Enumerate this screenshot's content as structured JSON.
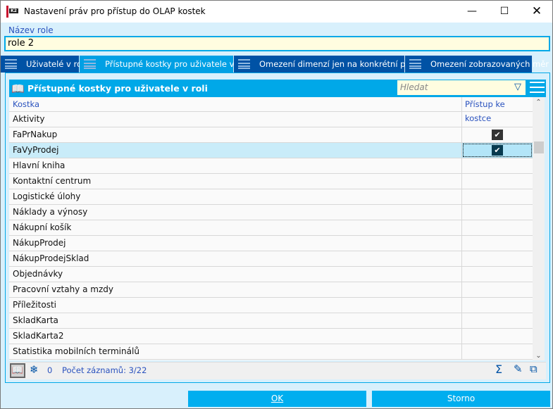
{
  "window": {
    "title": "Nastavení práv pro přístup do OLAP kostek",
    "logo": "K2"
  },
  "role": {
    "label": "Název role",
    "value": "role 2"
  },
  "tabs": [
    {
      "label": "Uživatelé v roli",
      "active": false
    },
    {
      "label": "Přístupné kostky pro uživatele v roli",
      "active": true
    },
    {
      "label": "Omezení dimenzí jen na konkrétní prvky",
      "active": false
    },
    {
      "label": "Omezení zobrazovaných měr",
      "active": false
    }
  ],
  "panel": {
    "title": "Přístupné kostky pro uživatele v roli",
    "search_placeholder": "Hledat"
  },
  "table": {
    "columns": [
      "Kostka",
      "Přístup ke kostce"
    ],
    "rows": [
      {
        "name": "Aktivity",
        "access": false
      },
      {
        "name": "FaPrNakup",
        "access": true
      },
      {
        "name": "FaVyProdej",
        "access": true,
        "selected": true
      },
      {
        "name": "Hlavní kniha",
        "access": false
      },
      {
        "name": "Kontaktní centrum",
        "access": false
      },
      {
        "name": "Logistické úlohy",
        "access": false
      },
      {
        "name": "Náklady a výnosy",
        "access": false
      },
      {
        "name": "Nákupní košík",
        "access": false
      },
      {
        "name": "NákupProdej",
        "access": false
      },
      {
        "name": "NákupProdejSklad",
        "access": false
      },
      {
        "name": "Objednávky",
        "access": false
      },
      {
        "name": "Pracovní vztahy a mzdy",
        "access": false
      },
      {
        "name": "Příležitosti",
        "access": false
      },
      {
        "name": "SkladKarta",
        "access": false
      },
      {
        "name": "SkladKarta2",
        "access": false
      },
      {
        "name": "Statistika mobilních terminálů",
        "access": false
      }
    ]
  },
  "status": {
    "freeze_count": "0",
    "records": "Počet záznamů: 3/22"
  },
  "buttons": {
    "ok": "OK",
    "cancel": "Storno"
  }
}
